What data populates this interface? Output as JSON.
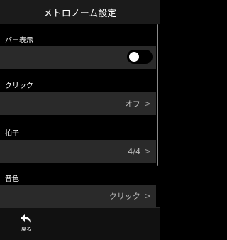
{
  "header": {
    "title": "メトロノーム設定"
  },
  "sections": {
    "bar_display": {
      "label": "バー表示",
      "toggle": {
        "state": "off",
        "icon": "toggle-switch"
      }
    },
    "click": {
      "label": "クリック",
      "value": "オフ"
    },
    "time_signature": {
      "label": "拍子",
      "value": "4/4"
    },
    "tone": {
      "label": "音色",
      "value": "クリック"
    }
  },
  "icons": {
    "chevron": ">",
    "back": "back-arrow-icon"
  },
  "footer": {
    "back_label": "戻る"
  },
  "colors": {
    "background": "#000000",
    "row": "#2a2a2a",
    "header": "#1b1b1b",
    "toggle_off": "#000000",
    "toggle_knob": "#ffffff"
  }
}
